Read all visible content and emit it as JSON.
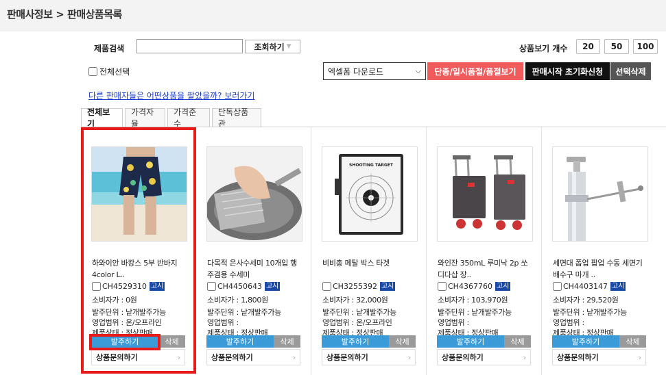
{
  "breadcrumb": "판매사정보 > 판매상품목록",
  "search": {
    "label": "제품검색",
    "value": "",
    "placeholder": "",
    "button_label": "조회하기",
    "button_arrow": "▼"
  },
  "view_count": {
    "label": "상품보기 개수",
    "options": [
      "20",
      "50",
      "100"
    ]
  },
  "select_all_label": "전체선택",
  "excel_select": {
    "selected": "엑셀폼 다운로드",
    "chevron": "⌵"
  },
  "actions": {
    "discontinued": "단종/일시품절/품절보기",
    "reset_request": "판매시작 초기화신청",
    "delete_selected": "선택삭제"
  },
  "other_sellers_link": "다른 판매자들은 어떤상품을 팔았을까? 보러가기",
  "tabs": [
    "전체보기",
    "가격자율",
    "가격준수",
    "단독상품관"
  ],
  "colors": {
    "accent_red": "#e81b1b",
    "discontinued_bg": "#f05b5b",
    "order_blue": "#3b9bd9",
    "badge_blue": "#1a4aa8",
    "link_blue": "#1a3cc8"
  },
  "products": [
    {
      "name": "하와이안 바캉스 5부 반바지 4color L..",
      "code": "CH4529310",
      "badge": "고시",
      "consumer_price": "소비자가 : 0원",
      "order_unit": "발주단위 : 낱개발주가능",
      "sales_scope": "영업범위 : 온/오프라인",
      "status": "제품상태 : 정상판매",
      "order_label": "발주하기",
      "delete_label": "삭제",
      "inquiry_label": "상품문의하기",
      "inquiry_chevron": "›",
      "image_icon": "shorts-beach-image"
    },
    {
      "name": "다목적 은사수세미 10개입 행주겸용 수세미",
      "code": "CH4450643",
      "badge": "고시",
      "consumer_price": "소비자가 : 1,800원",
      "order_unit": "발주단위 : 낱개발주가능",
      "sales_scope": "영업범위 :",
      "status": "제품상태 : 정상판매",
      "order_label": "발주하기",
      "delete_label": "삭제",
      "inquiry_label": "상품문의하기",
      "inquiry_chevron": "›",
      "image_icon": "scrubber-pan-image"
    },
    {
      "name": "비비총 메탈 박스 타겟",
      "code": "CH3255392",
      "badge": "고시",
      "consumer_price": "소비자가 : 32,000원",
      "order_unit": "발주단위 : 낱개발주가능",
      "sales_scope": "영업범위 : 온/오프라인",
      "status": "제품상태 : 정상판매",
      "order_label": "발주하기",
      "delete_label": "삭제",
      "inquiry_label": "상품문의하기",
      "inquiry_chevron": "›",
      "image_icon": "target-box-image",
      "image_caption": "SHOOTING TARGET"
    },
    {
      "name": "와인잔 350mL 루미낙 2p 쏘 디다샵 장..",
      "code": "CH4367760",
      "badge": "고시",
      "consumer_price": "소비자가 : 103,970원",
      "order_unit": "발주단위 : 낱개발주가능",
      "sales_scope": "영업범위 :",
      "status": "제품상태 : 정상판매",
      "order_label": "발주하기",
      "delete_label": "삭제",
      "inquiry_label": "상품문의하기",
      "inquiry_chevron": "›",
      "image_icon": "shopping-cart-image"
    },
    {
      "name": "세면대 폽업 팝업 수동 세면기 배수구 마개 ..",
      "code": "CH4403147",
      "badge": "고시",
      "consumer_price": "소비자가 : 29,520원",
      "order_unit": "발주단위 : 낱개발주가능",
      "sales_scope": "영업범위 :",
      "status": "제품상태 : 정상판매",
      "order_label": "발주하기",
      "delete_label": "삭제",
      "inquiry_label": "상품문의하기",
      "inquiry_chevron": "›",
      "image_icon": "drain-plug-image"
    }
  ]
}
